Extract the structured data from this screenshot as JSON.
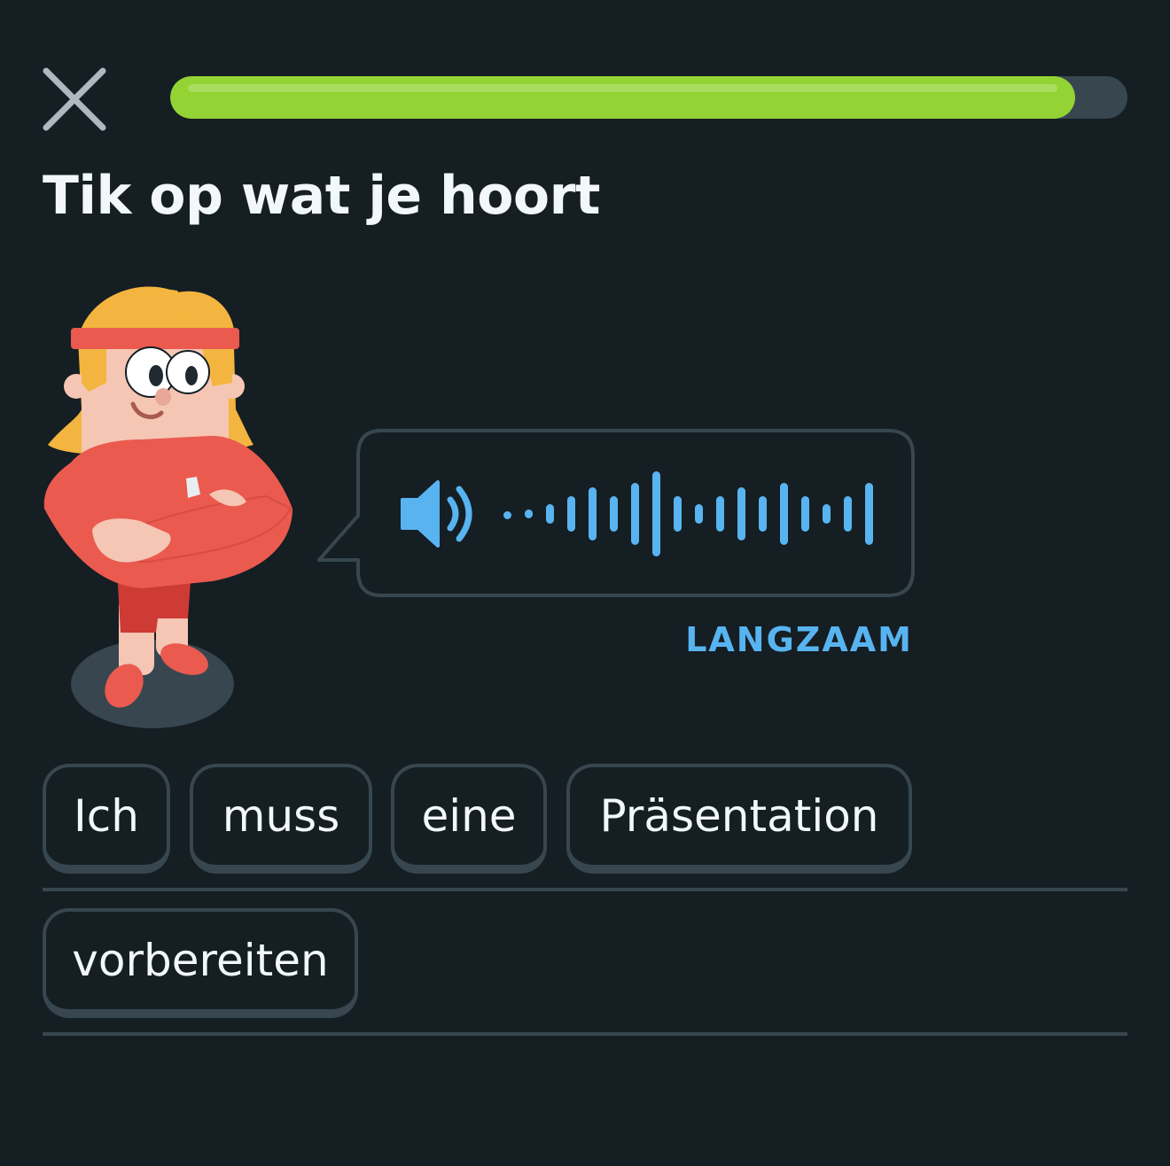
{
  "header": {
    "close_icon": "close-icon",
    "progress": 0.945
  },
  "prompt": {
    "title": "Tik op wat je hoort"
  },
  "audio": {
    "speaker_icon": "speaker-icon",
    "waveform_icon": "waveform-icon",
    "slow_label": "LANGZAAM"
  },
  "word_bank": {
    "words": [
      "Ich",
      "muss",
      "eine",
      "Präsentation",
      "vorbereiten"
    ]
  },
  "colors": {
    "background": "#151e23",
    "progress_fill": "#93d333",
    "progress_track": "#37464f",
    "accent_blue": "#58b4f0",
    "border": "#37464f",
    "text": "#f1f7fb"
  }
}
